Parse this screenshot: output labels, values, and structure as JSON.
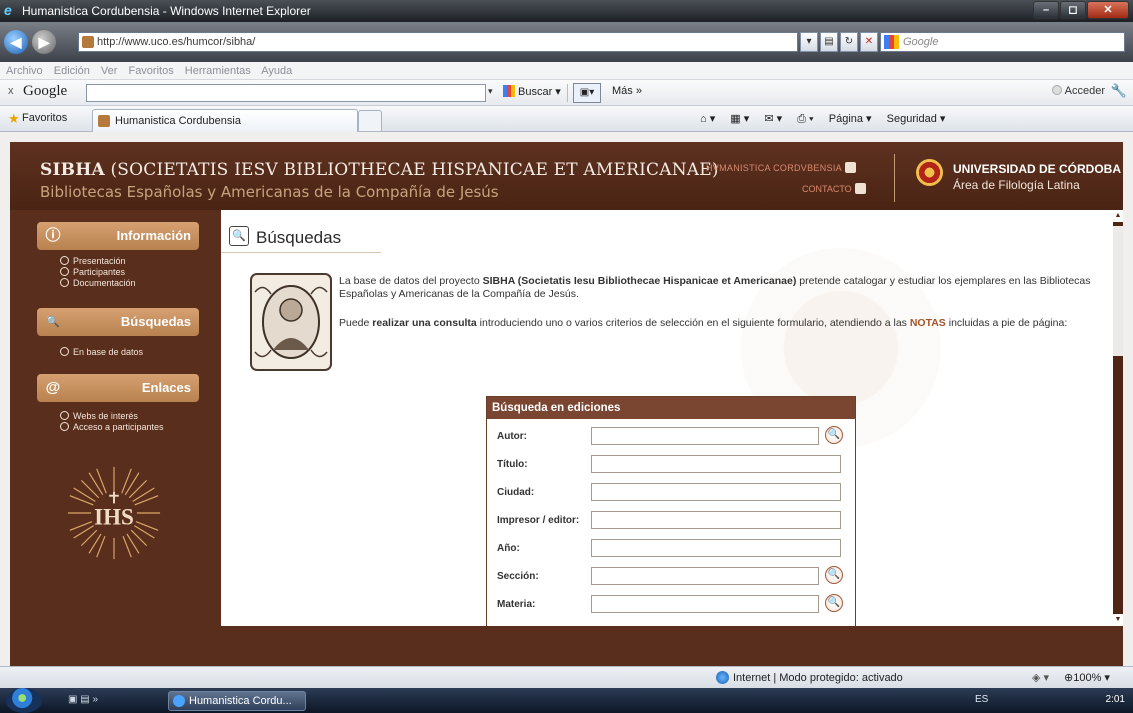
{
  "window": {
    "title": "Humanistica Cordubensia - Windows Internet Explorer",
    "controls": [
      "–",
      "◻",
      "✕"
    ]
  },
  "addressbar": {
    "url": "http://www.uco.es/humcor/sibha/",
    "search_placeholder": "Google"
  },
  "menubar": {
    "items": [
      "Archivo",
      "Edición",
      "Ver",
      "Favoritos",
      "Herramientas",
      "Ayuda"
    ]
  },
  "google_toolbar": {
    "close": "x",
    "logo": "Google",
    "search_value": "",
    "buscar_label": "Buscar ▾",
    "mas_label": "Más »",
    "acceder_label": "Acceder"
  },
  "favbar": {
    "favoritos_label": "Favoritos",
    "tab_title": "Humanistica Cordubensia",
    "commands": [
      "Página ▾",
      "Seguridad ▾"
    ]
  },
  "header": {
    "title_bold": "SIBHA",
    "title_rest": " (SOCIETATIS IESV BIBLIOTHECAE HISPANICAE ET AMERICANAE)",
    "subtitle": "Bibliotecas Españolas y Americanas de la Compañía de Jesús",
    "humanistica_link": "HVMANISTICA CORDVBENSIA",
    "contact_link": "CONTACTO",
    "university_name": "UNIVERSIDAD DE CÓRDOBA",
    "university_area": "Área de Filología Latina"
  },
  "sidebar": {
    "sections": [
      {
        "label": "Información",
        "icon": "info-icon",
        "icon_glyph": "ⓘ",
        "items": [
          "Presentación",
          "Participantes",
          "Documentación"
        ]
      },
      {
        "label": "Búsquedas",
        "icon": "search-icon",
        "icon_glyph": "🔍",
        "items": [
          "En base de datos"
        ]
      },
      {
        "label": "Enlaces",
        "icon": "at-icon",
        "icon_glyph": "@",
        "items": [
          "Webs de interés",
          "Acceso a participantes"
        ]
      }
    ],
    "emblem_text": "IHS"
  },
  "main": {
    "title": "Búsquedas",
    "intro1_pre": "La base de datos del proyecto ",
    "intro1_bold": "SIBHA (Societatis Iesu Bibliothecae Hispanicae et Americanae)",
    "intro1_post": " pretende catalogar y estudiar los ejemplares en las Bibliotecas Españolas y Americanas de la Compañía de Jesús.",
    "intro2_pre": "Puede ",
    "intro2_bold": "realizar una consulta",
    "intro2_mid": " introduciendo uno o varios criterios de selección en el siguiente formulario, atendiendo a las ",
    "intro2_notas": "NOTAS",
    "intro2_post": " incluidas a pie de página:"
  },
  "search_form": {
    "heading": "Búsqueda en ediciones",
    "fields": [
      {
        "label": "Autor:",
        "value": "",
        "has_lookup": true
      },
      {
        "label": "Título:",
        "value": "",
        "has_lookup": false
      },
      {
        "label": "Ciudad:",
        "value": "",
        "has_lookup": false
      },
      {
        "label": "Impresor / editor:",
        "value": "",
        "has_lookup": false
      },
      {
        "label": "Año:",
        "value": "",
        "has_lookup": false
      },
      {
        "label": "Sección:",
        "value": "",
        "has_lookup": true
      },
      {
        "label": "Materia:",
        "value": "",
        "has_lookup": true
      }
    ]
  },
  "statusbar": {
    "zone": "Internet | Modo protegido: activado",
    "zoom": "100%"
  },
  "taskbar": {
    "task_label": "Humanistica Cordu...",
    "language": "ES",
    "clock": "2:01"
  },
  "colors": {
    "site_brown": "#5a2e1c",
    "nav_tan": "#c48e5e",
    "accent_orange": "#a4532a",
    "form_header": "#7a4632"
  }
}
